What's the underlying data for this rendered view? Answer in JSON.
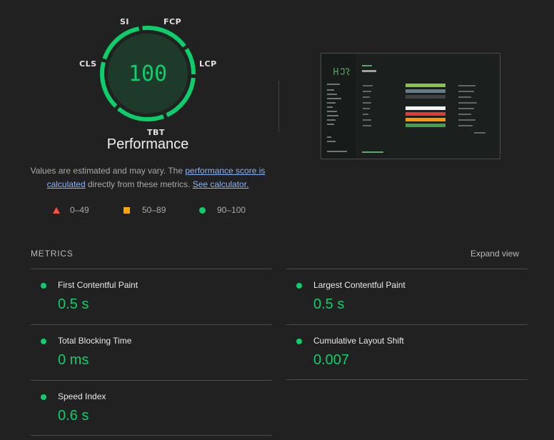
{
  "gauge": {
    "score": "100",
    "title": "Performance",
    "labels": {
      "si": "SI",
      "fcp": "FCP",
      "lcp": "LCP",
      "tbt": "TBT",
      "cls": "CLS"
    },
    "color": "#0cce6b"
  },
  "description": {
    "text_1": "Values are estimated and may vary. The ",
    "link_1": "performance score is calculated",
    "text_2": " directly from these metrics. ",
    "link_2": "See calculator."
  },
  "legend": {
    "fail": "0–49",
    "average": "50–89",
    "pass": "90–100"
  },
  "metrics_section": {
    "heading": "METRICS",
    "expand_label": "Expand view",
    "items": [
      {
        "title": "First Contentful Paint",
        "value": "0.5 s"
      },
      {
        "title": "Largest Contentful Paint",
        "value": "0.5 s"
      },
      {
        "title": "Total Blocking Time",
        "value": "0 ms"
      },
      {
        "title": "Cumulative Layout Shift",
        "value": "0.007"
      },
      {
        "title": "Speed Index",
        "value": "0.6 s"
      }
    ]
  },
  "colors": {
    "pass": "#0cce6b",
    "average": "#ffa400",
    "fail": "#ff4e42",
    "link": "#8ab4f8",
    "background": "#212121"
  }
}
